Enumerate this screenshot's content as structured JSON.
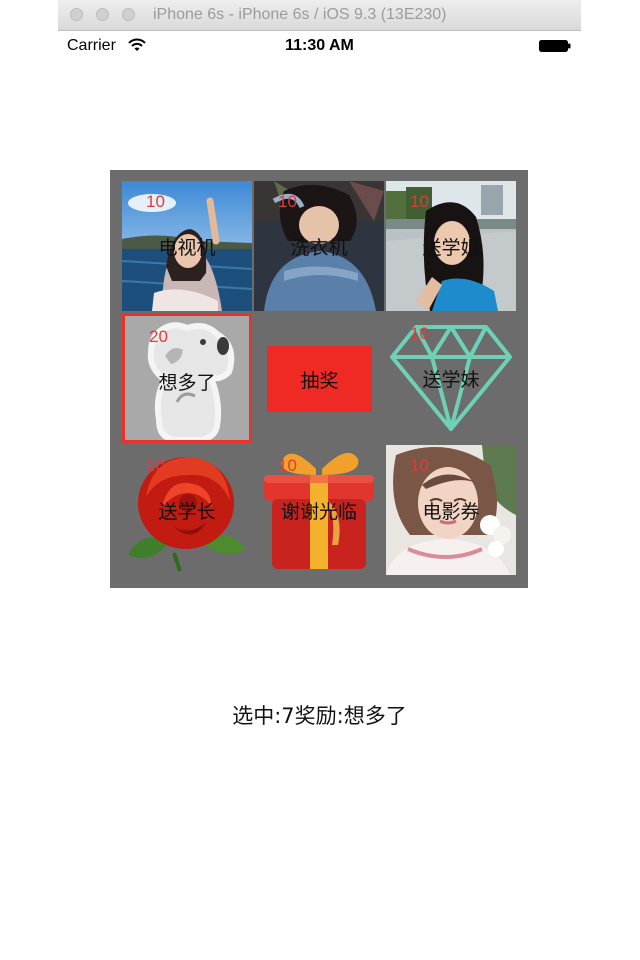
{
  "window": {
    "title": "iPhone 6s - iPhone 6s / iOS 9.3 (13E230)"
  },
  "status_bar": {
    "carrier": "Carrier",
    "time": "11:30 AM"
  },
  "board": {
    "cells": [
      {
        "label": "电视机",
        "count": "10",
        "icon": "photo-girl-by-lake"
      },
      {
        "label": "洗衣机",
        "count": "10",
        "icon": "photo-girl-in-denim"
      },
      {
        "label": "送学姐",
        "count": "10",
        "icon": "photo-girl-selfie-campus"
      },
      {
        "label": "想多了",
        "count": "20",
        "icon": "koala-sticker",
        "selected": true
      },
      {
        "label": "送学妹",
        "count": "10",
        "icon": "diamond-outline"
      },
      {
        "label": "送学长",
        "count": "10",
        "icon": "red-rose"
      },
      {
        "label": "谢谢光临",
        "count": "10",
        "icon": "gift-box"
      },
      {
        "label": "电影券",
        "count": "10",
        "icon": "photo-girl-with-flowers"
      }
    ],
    "draw_button": "抽奖",
    "colors": {
      "board": "#6c6c6c",
      "button": "#ef2a25",
      "count": "#e23a3a",
      "selection": "#e8322e"
    }
  },
  "result_text": "选中:7奖励:想多了"
}
